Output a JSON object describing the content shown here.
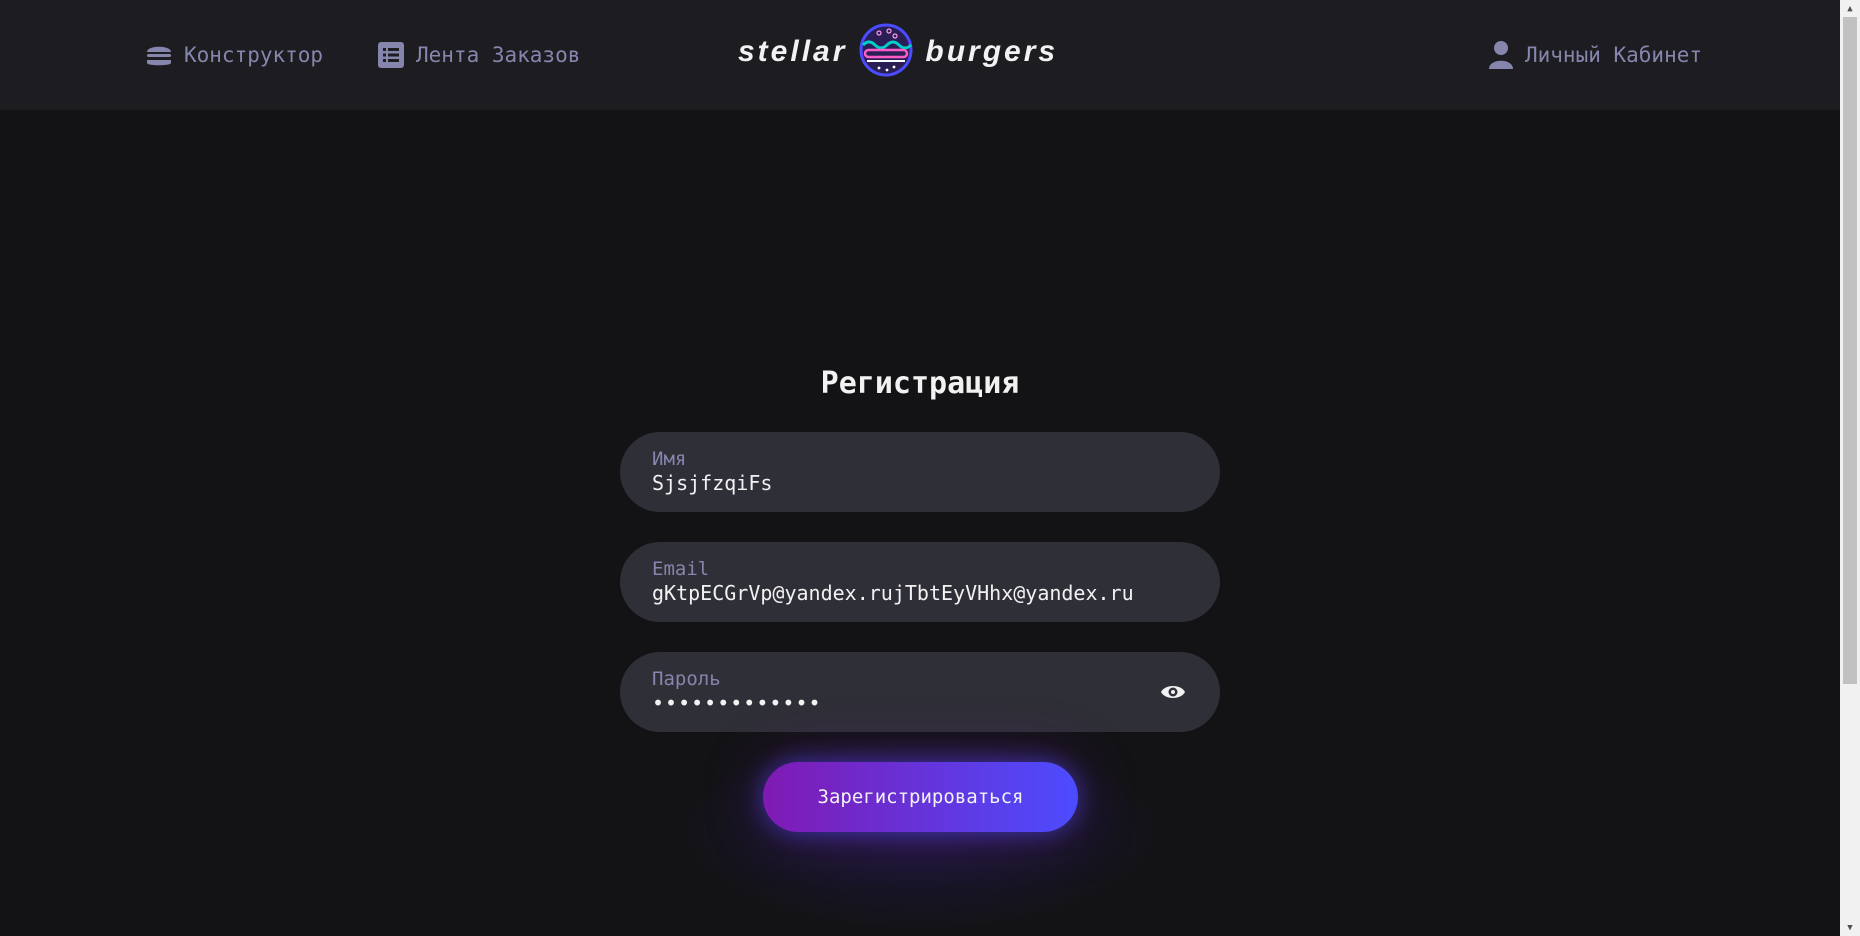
{
  "header": {
    "nav_constructor": "Конструктор",
    "nav_feed": "Лента Заказов",
    "nav_account": "Личный Кабинет",
    "logo_left": "stellar",
    "logo_right": "burgers"
  },
  "form": {
    "title": "Регистрация",
    "name_label": "Имя",
    "name_value": "SjsjfzqiFs",
    "email_label": "Email",
    "email_value": "gKtpECGrVp@yandex.rujTbtEyVHhx@yandex.ru",
    "password_label": "Пароль",
    "password_value": "•••••••••••••",
    "submit_label": "Зарегистрироваться"
  },
  "colors": {
    "background": "#131316",
    "header": "#1c1c21",
    "field": "#2f2f37",
    "inactive_text": "#8585ad",
    "primary_text": "#f2f2f3",
    "button_gradient_start": "#801ab3",
    "button_gradient_end": "#4c4cff"
  },
  "icons": {
    "constructor": "burger-icon",
    "feed": "list-icon",
    "account": "profile-icon",
    "password_toggle": "eye-icon",
    "logo": "burger-logo-icon"
  }
}
